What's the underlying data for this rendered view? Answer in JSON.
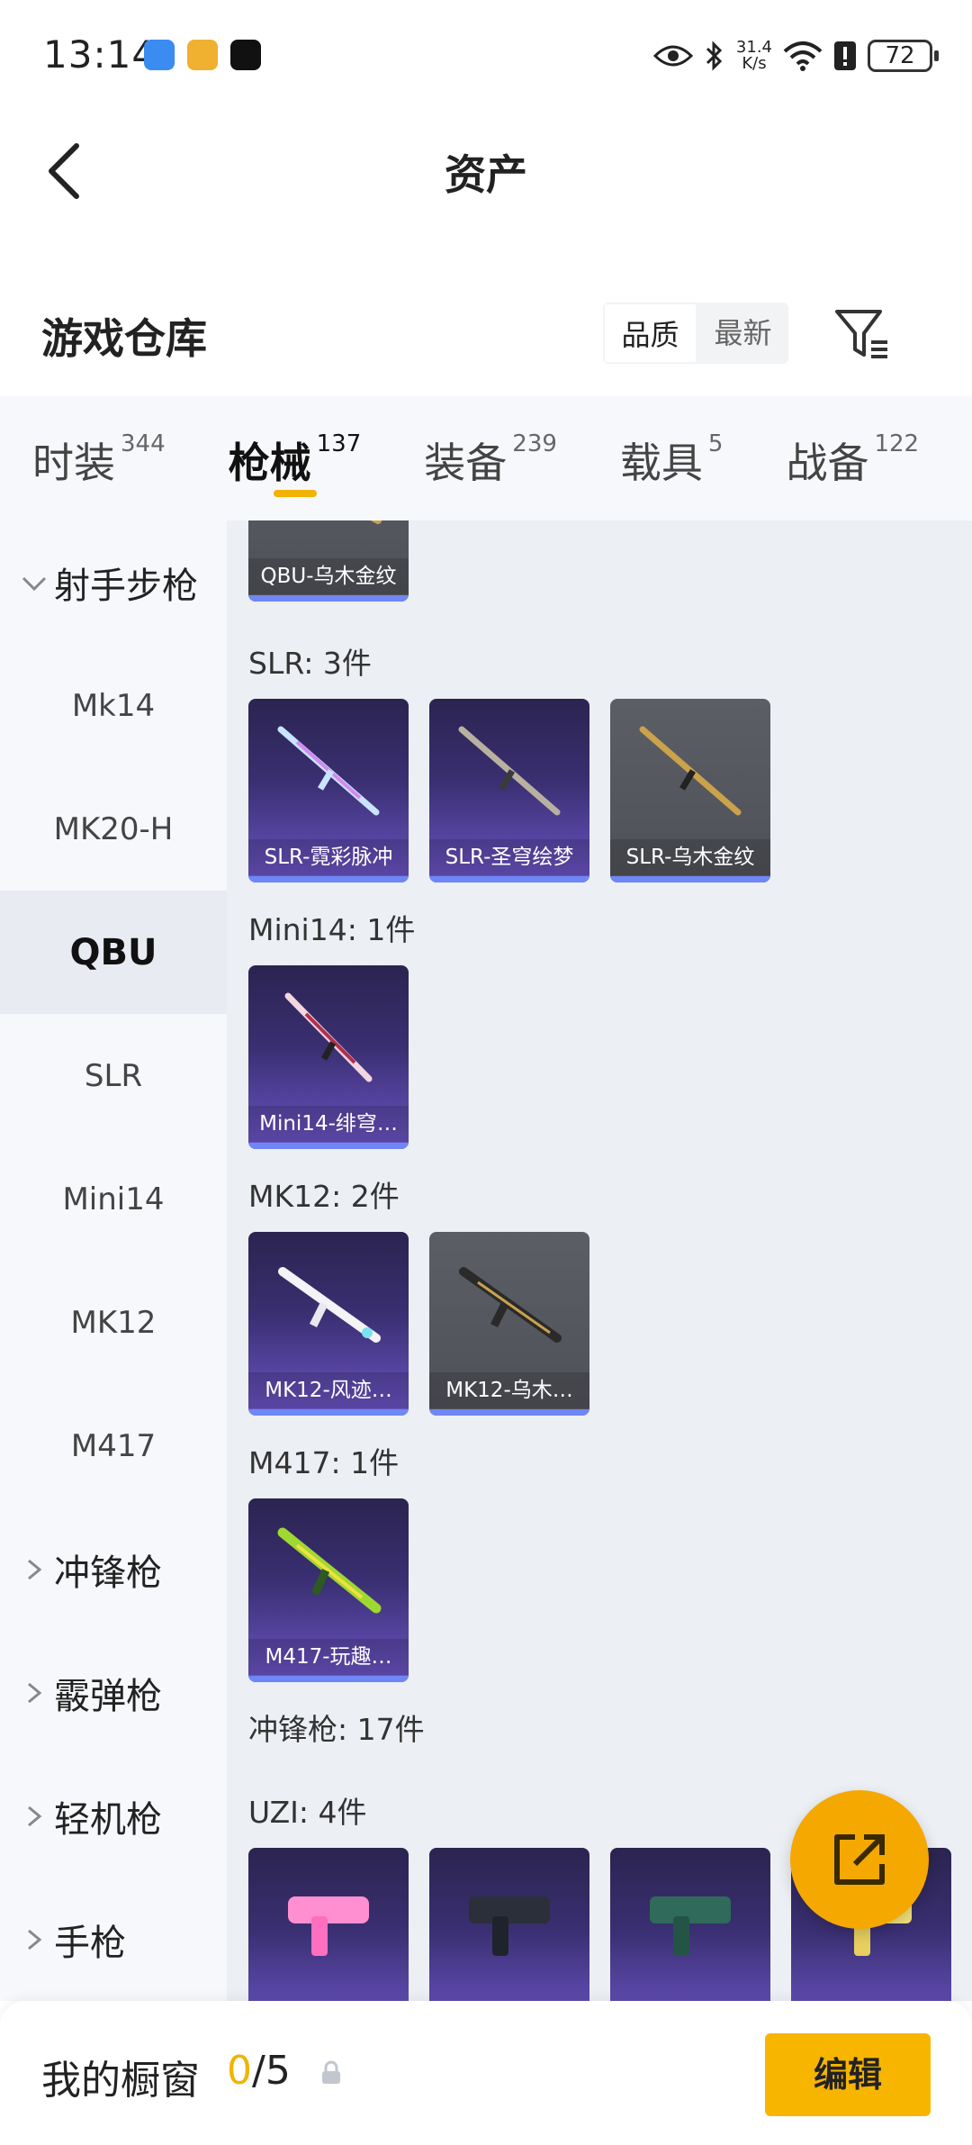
{
  "status_bar": {
    "time": "13:14",
    "net_speed_value": "31.4",
    "net_speed_unit": "K/s",
    "battery": "72"
  },
  "header": {
    "title": "资产"
  },
  "warehouse": {
    "title": "游戏仓库",
    "sort_options": [
      "品质",
      "最新"
    ],
    "active_sort": "品质"
  },
  "tabs": [
    {
      "label": "时装",
      "count": "344"
    },
    {
      "label": "枪械",
      "count": "137",
      "active": true
    },
    {
      "label": "装备",
      "count": "239"
    },
    {
      "label": "载具",
      "count": "5"
    },
    {
      "label": "战备",
      "count": "122"
    }
  ],
  "sidebar": {
    "items": [
      {
        "label": "射手步枪",
        "type": "group-expanded"
      },
      {
        "label": "Mk14"
      },
      {
        "label": "MK20-H"
      },
      {
        "label": "QBU",
        "selected": true
      },
      {
        "label": "SLR"
      },
      {
        "label": "Mini14"
      },
      {
        "label": "MK12"
      },
      {
        "label": "M417"
      },
      {
        "label": "冲锋枪",
        "type": "group"
      },
      {
        "label": "霰弹枪",
        "type": "group"
      },
      {
        "label": "轻机枪",
        "type": "group"
      },
      {
        "label": "手枪",
        "type": "group"
      }
    ]
  },
  "content": {
    "qbu_card": "QBU-乌木金纹",
    "slr": {
      "label": "SLR: 3件",
      "cards": [
        "SLR-霓彩脉冲",
        "SLR-圣穹绘梦",
        "SLR-乌木金纹"
      ]
    },
    "mini14": {
      "label": "Mini14: 1件",
      "cards": [
        "Mini14-绯穹…"
      ]
    },
    "mk12": {
      "label": "MK12: 2件",
      "cards": [
        "MK12-风迹…",
        "MK12-乌木…"
      ]
    },
    "m417": {
      "label": "M417: 1件",
      "cards": [
        "M417-玩趣…"
      ]
    },
    "smg_label": "冲锋枪: 17件",
    "uzi_label": "UZI: 4件"
  },
  "bottom_bar": {
    "label": "我的橱窗",
    "count_current": "0",
    "count_total": "/5",
    "edit_label": "编辑"
  },
  "colors": {
    "accent": "#f7b500",
    "rare_card": "#3a2f72",
    "normal_card": "#55575e",
    "card_bar": "#6f86f5"
  },
  "icons": [
    "back-arrow-icon",
    "filter-icon",
    "chevron-down-icon",
    "chevron-right-icon",
    "share-external-icon",
    "lock-icon",
    "eye-icon",
    "bluetooth-icon",
    "wifi-icon"
  ]
}
